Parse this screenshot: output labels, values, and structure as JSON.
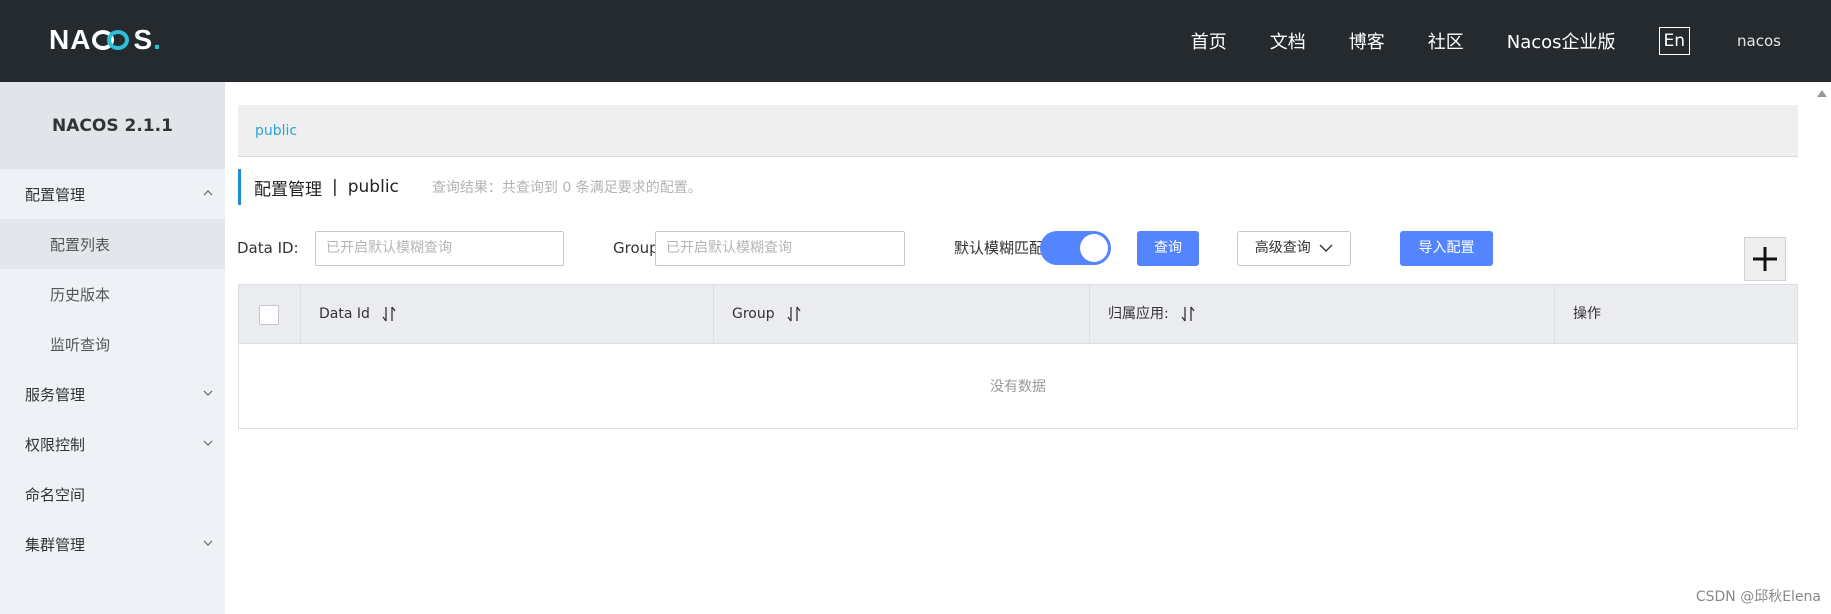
{
  "header": {
    "logo": {
      "pre": "NA",
      "post": "S",
      "dot": "."
    },
    "nav": [
      "首页",
      "文档",
      "博客",
      "社区",
      "Nacos企业版"
    ],
    "lang_button": "En",
    "user": "nacos"
  },
  "sidebar": {
    "version": "NACOS 2.1.1",
    "items": [
      {
        "label": "配置管理",
        "chevron": "up"
      },
      {
        "label": "配置列表"
      },
      {
        "label": "历史版本"
      },
      {
        "label": "监听查询"
      },
      {
        "label": "服务管理",
        "chevron": "down"
      },
      {
        "label": "权限控制",
        "chevron": "down"
      },
      {
        "label": "命名空间"
      },
      {
        "label": "集群管理",
        "chevron": "down"
      }
    ]
  },
  "breadcrumb": {
    "namespace": "public"
  },
  "title": {
    "main": "配置管理",
    "separator": "|",
    "namespace": "public",
    "summary": "查询结果：共查询到 0 条满足要求的配置。"
  },
  "filters": {
    "data_id_label": "Data ID:",
    "data_id_placeholder": "已开启默认模糊查询",
    "group_label": "Group:",
    "group_placeholder": "已开启默认模糊查询",
    "fuzzy_label": "默认模糊匹配:",
    "fuzzy_enabled": true,
    "search_button": "查询",
    "advanced_button": "高级查询",
    "import_button": "导入配置",
    "add_button": "+"
  },
  "table": {
    "columns": [
      "Data Id",
      "Group",
      "归属应用:",
      "操作"
    ],
    "empty_text": "没有数据"
  },
  "watermark": "CSDN @邱秋Elena",
  "colors": {
    "primary": "#5584ff",
    "header_bg": "#252a2f",
    "sidebar_bg": "#eef1f5",
    "link": "#2aa4d8"
  }
}
